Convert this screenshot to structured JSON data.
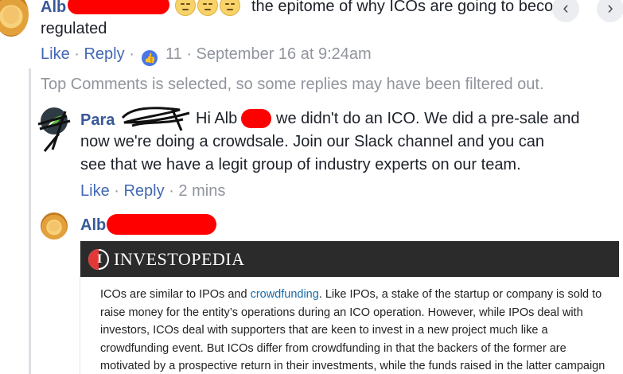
{
  "comment1": {
    "author_visible": "Alb",
    "text": "the epitome of why ICOs are going to become",
    "text_cont": "regulated",
    "emoji_count": 3,
    "actions": {
      "like": "Like",
      "reply": "Reply",
      "reactions_count": "11",
      "timestamp": "September 16 at 9:24am"
    }
  },
  "filter_notice": "Top Comments is selected, so some replies may have been filtered out.",
  "reply1": {
    "author_visible": "Para",
    "greeting": "Hi Alb",
    "text_rest": "we didn't do an ICO. We did a pre-sale and",
    "line2": "now we're doing a crowdsale. Join our Slack channel and you can",
    "line3": "see that we have a legit group of industry experts on our team.",
    "actions": {
      "like": "Like",
      "reply": "Reply",
      "timestamp": "2 mins"
    }
  },
  "reply2": {
    "author_visible": "Alb"
  },
  "investopedia": {
    "brand": "INVESTOPEDIA",
    "logo_letter": "I",
    "line1_pre": "ICOs are similar to IPOs and ",
    "line1_link": "crowdfunding",
    "line1_post": ". Like IPOs, a stake of the startup or company is sold to",
    "line2": "raise money for the entity’s operations during an ICO operation. However, while IPOs deal with",
    "line3": "investors, ICOs deal with supporters that are keen to invest in a new project much like a",
    "line4": "crowdfunding event. But ICOs differ from crowdfunding in that the backers of the former are",
    "line5": "motivated by a prospective return in their investments, while the funds raised in the latter campaign"
  },
  "nav": {
    "prev": "‹",
    "next": "›"
  },
  "colors": {
    "name": "#385898",
    "link": "#4267b2",
    "meta": "#90949c",
    "redaction": "#ff0000",
    "investopedia_header": "#2b2b2b"
  }
}
